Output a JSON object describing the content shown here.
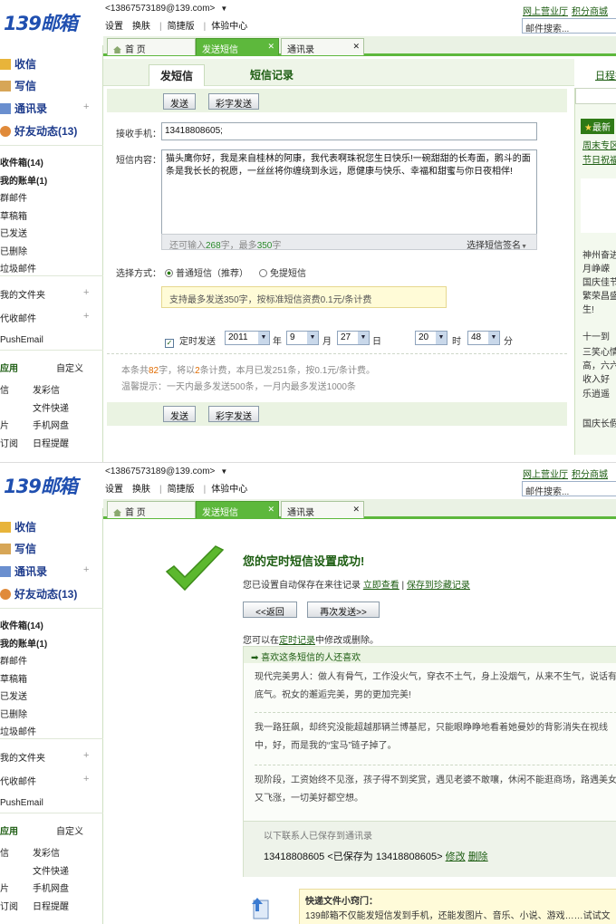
{
  "header": {
    "logo": "139邮箱",
    "account": "<13867573189@139.com>",
    "nav": [
      "设置",
      "换肤",
      "简捷版",
      "体验中心"
    ],
    "links": [
      "网上营业厅",
      "积分商城"
    ],
    "search_placeholder": "邮件搜索..."
  },
  "tabs": {
    "home": "首 页",
    "send_sms": "发送短信",
    "contacts": "通讯录"
  },
  "sidebar": {
    "inbox": "收信",
    "compose": "写信",
    "contacts": "通讯录",
    "friends": "好友动态(13)",
    "folders": [
      "收件箱(14)",
      "我的账单(1)",
      "群邮件",
      "草稿箱",
      "已发送",
      "已删除",
      "垃圾邮件"
    ],
    "my_folders": "我的文件夹",
    "agent_mail": "代收邮件",
    "pushemail": "PushEmail",
    "apps_title": "应用",
    "apps_custom": "自定义",
    "apps_left": [
      "信",
      "片",
      "订阅"
    ],
    "apps_right": [
      "发彩信",
      "文件快递",
      "手机网盘",
      "日程提醒"
    ]
  },
  "sms_form": {
    "subtab_send": "发短信",
    "subtab_records": "短信记录",
    "right_link": "日程提",
    "btn_send": "发送",
    "btn_color_send": "彩字发送",
    "recipient_label": "接收手机：",
    "recipient_value": "13418808605;",
    "content_label": "短信内容：",
    "content_value": "猫头鹰你好，我是来自桂林的阿康，我代表啊珠祝您生日快乐!一碗甜甜的长寿面，鹅斗的面条是我长长的祝愿，一丝丝将你缠绕到永远，愿健康与快乐、幸福和甜蜜与你日夜相伴!",
    "counter_prefix": "还可输入",
    "counter_number": "268",
    "counter_suffix": "字，最多",
    "counter_max": "350",
    "counter_unit": "字",
    "signature": "选择短信签名",
    "mode_label": "选择方式：",
    "mode_normal": "普通短信（推荐）",
    "mode_free": "免提短信",
    "hint": "支持最多发送350字，按标准短信资费0.1元/条计费",
    "schedule_label": "定时发送",
    "year": "2011",
    "year_unit": "年",
    "month": "9",
    "month_unit": "月",
    "day": "27",
    "day_unit": "日",
    "hour": "20",
    "hour_unit": "时",
    "minute": "48",
    "minute_unit": "分",
    "stats_a": "本条共",
    "stats_b": "82",
    "stats_c": "字，将以",
    "stats_d": "2",
    "stats_e": "条计费，本月已发251条，按0.1元/条计费。",
    "reminder": "温馨提示：一天内最多发送500条，一月内最多发送1000条"
  },
  "right_panel": {
    "latest": "最新",
    "lines": [
      "周末专区",
      "节日祝福",
      "神州奋进",
      "月峥嵘",
      "国庆佳节",
      "繁荣昌盛",
      "生!",
      "十一到",
      "三笑心情",
      "高，六六",
      "收入好",
      "乐逍遥",
      "国庆长假"
    ]
  },
  "result": {
    "title": "您的定时短信设置成功!",
    "saved_text": "您已设置自动保存在来往记录",
    "view_now": "立即查看",
    "save_fav": "保存到珍藏记录",
    "btn_back": "<<返回",
    "btn_again": "再次发送>>",
    "edit_pre": "您可以在",
    "edit_link": "定时记录",
    "edit_post": "中修改或删除。",
    "like_header": "喜欢这条短信的人还喜欢",
    "like_1": "现代完美男人：做人有骨气，工作没火气，穿衣不土气，身上没烟气，从来不生气，说话有底气。祝女的邂逅完美，男的更加完美!",
    "like_2": "我一路狂飙，却终究没能超越那辆兰博基尼，只能眼睁睁地看着她曼妙的背影消失在视线中，好，而是我的“宝马”链子掉了。",
    "like_3": "现阶段，工资始终不见涨，孩子得不到奖赏，遇见老婆不敢嚷，休闲不能逛商场，路遇美女又飞涨，一切美好都空想。",
    "saved_notice": "以下联系人已保存到通讯录",
    "saved_contact": "13418808605 <已保存为 13418808605>",
    "edit": "修改",
    "delete": "删除",
    "tip_title": "快递文件小窍门：",
    "tip_text": "139邮箱不仅能发短信发到手机，还能发图片、音乐、小说、游戏……试试文"
  },
  "colors": {
    "green": "#5db83c",
    "dark_green": "#1d5d12",
    "blue_logo": "#1f4fb0",
    "orange": "#e06b00"
  }
}
